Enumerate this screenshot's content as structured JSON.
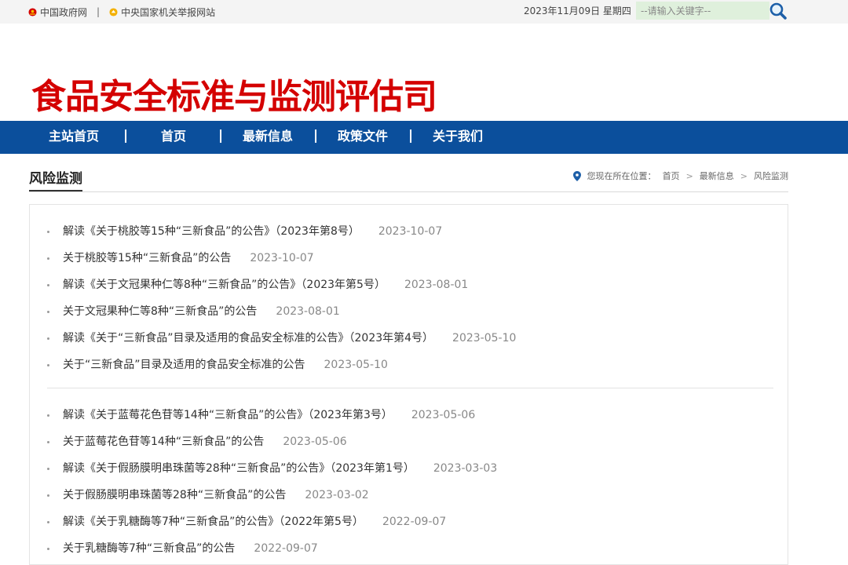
{
  "topbar": {
    "link1": "中国政府网",
    "separator": "|",
    "link2": "中央国家机关举报网站",
    "date": "2023年11月09日 星期四",
    "search_placeholder": "--请输入关键字--"
  },
  "site_title": "食品安全标准与监测评估司",
  "nav": {
    "items": [
      "主站首页",
      "首页",
      "最新信息",
      "政策文件",
      "关于我们"
    ],
    "separator": "|"
  },
  "section": {
    "title": "风险监测",
    "breadcrumb_prefix": "您现在所在位置：",
    "breadcrumb": [
      "首页",
      "最新信息",
      "风险监测"
    ],
    "breadcrumb_sep": ">"
  },
  "list_group_1": [
    {
      "title": "解读《关于桃胶等15种“三新食品”的公告》（2023年第8号）",
      "date": "2023-10-07"
    },
    {
      "title": "关于桃胶等15种“三新食品”的公告",
      "date": "2023-10-07"
    },
    {
      "title": "解读《关于文冠果种仁等8种“三新食品”的公告》（2023年第5号）",
      "date": "2023-08-01"
    },
    {
      "title": "关于文冠果种仁等8种“三新食品”的公告",
      "date": "2023-08-01"
    },
    {
      "title": "解读《关于“三新食品”目录及适用的食品安全标准的公告》（2023年第4号）",
      "date": "2023-05-10"
    },
    {
      "title": "关于“三新食品”目录及适用的食品安全标准的公告",
      "date": "2023-05-10"
    }
  ],
  "list_group_2": [
    {
      "title": "解读《关于蓝莓花色苷等14种“三新食品”的公告》（2023年第3号）",
      "date": "2023-05-06"
    },
    {
      "title": "关于蓝莓花色苷等14种“三新食品”的公告",
      "date": "2023-05-06"
    },
    {
      "title": "解读《关于假肠膜明串珠菌等28种“三新食品”的公告》（2023年第1号）",
      "date": "2023-03-03"
    },
    {
      "title": "关于假肠膜明串珠菌等28种“三新食品”的公告",
      "date": "2023-03-02"
    },
    {
      "title": "解读《关于乳糖酶等7种“三新食品”的公告》（2022年第5号）",
      "date": "2022-09-07"
    },
    {
      "title": "关于乳糖酶等7种“三新食品”的公告",
      "date": "2022-09-07"
    }
  ],
  "colors": {
    "title_red": "#d40000",
    "nav_blue": "#0b4f9c",
    "search_bg": "#dff0dc"
  }
}
